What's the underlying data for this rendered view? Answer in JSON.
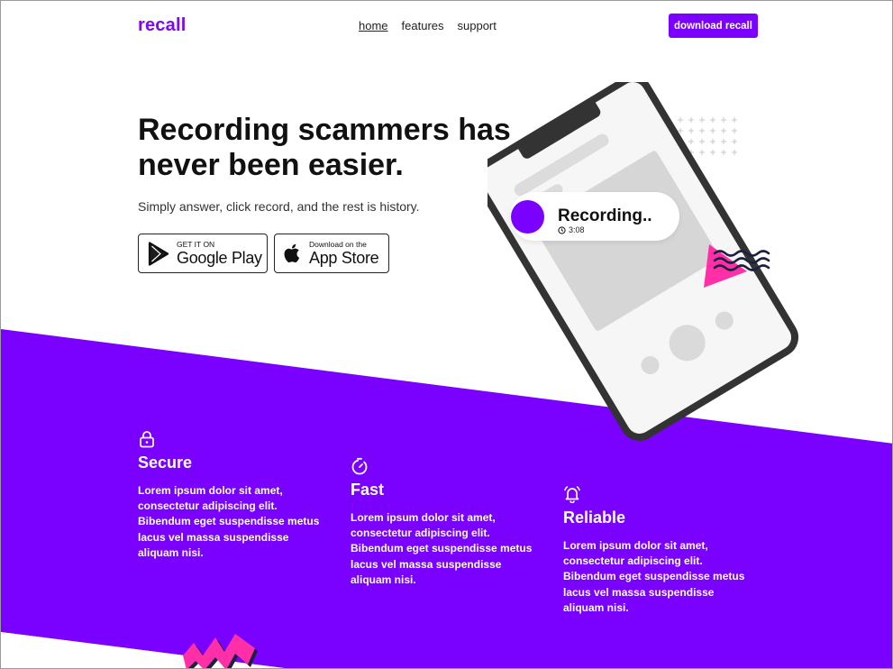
{
  "brand": {
    "logo": "recall",
    "accent": "#7a00ff",
    "highlight": "#ff3eb0"
  },
  "nav": {
    "items": [
      {
        "label": "home",
        "active": true
      },
      {
        "label": "features"
      },
      {
        "label": "support"
      }
    ]
  },
  "cta": {
    "label": "download recall"
  },
  "hero": {
    "title": "Recording scammers has never been easier.",
    "subtitle": "Simply answer, click record, and the rest is history."
  },
  "stores": {
    "google": {
      "small": "GET IT ON",
      "big": "Google Play",
      "icon": "google-play-icon"
    },
    "apple": {
      "small": "Download on the",
      "big": "App Store",
      "icon": "apple-icon"
    }
  },
  "recording": {
    "label": "Recording..",
    "time": "3:08"
  },
  "features": [
    {
      "title": "Secure",
      "icon": "lock-icon",
      "text": "Lorem ipsum dolor sit amet, consectetur adipiscing elit. Bibendum eget suspendisse metus lacus vel massa suspendisse aliquam nisi."
    },
    {
      "title": "Fast",
      "icon": "stopwatch-icon",
      "text": "Lorem ipsum dolor sit amet, consectetur adipiscing elit. Bibendum eget suspendisse metus lacus vel massa suspendisse aliquam nisi."
    },
    {
      "title": "Reliable",
      "icon": "bell-icon",
      "text": "Lorem ipsum dolor sit amet, consectetur adipiscing elit. Bibendum eget suspendisse metus lacus vel massa suspendisse aliquam nisi."
    }
  ]
}
